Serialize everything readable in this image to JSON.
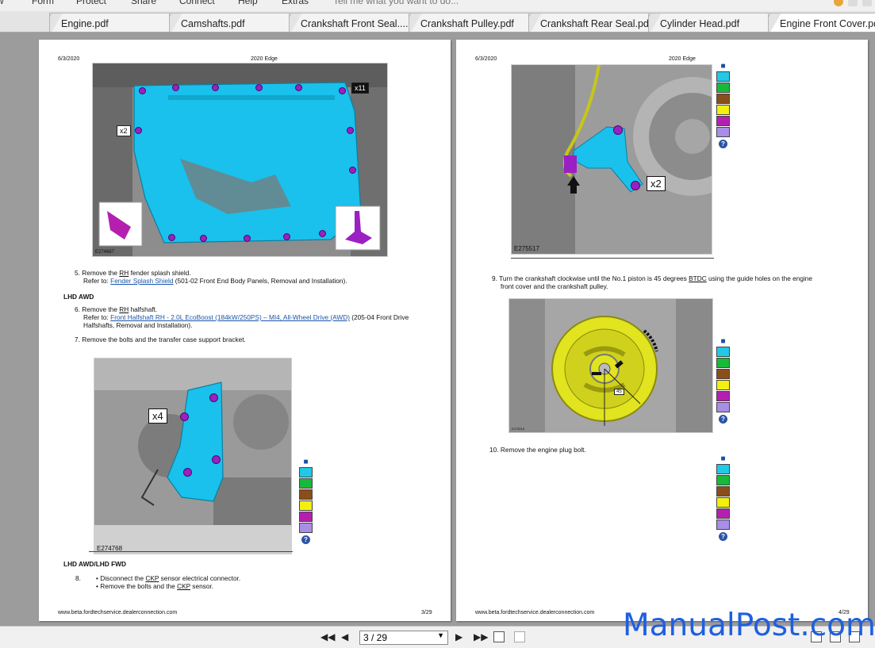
{
  "menu": {
    "items": [
      "Form",
      "Protect",
      "Share",
      "Connect",
      "Help",
      "Extras"
    ],
    "tell_me": "Tell me what you want to do..."
  },
  "tabs": [
    {
      "label": "Engine.pdf",
      "active": false
    },
    {
      "label": "Camshafts.pdf",
      "active": false
    },
    {
      "label": "Crankshaft Front Seal....",
      "active": false
    },
    {
      "label": "Crankshaft Pulley.pdf",
      "active": false
    },
    {
      "label": "Crankshaft Rear Seal.pdf",
      "active": false
    },
    {
      "label": "Cylinder Head.pdf",
      "active": false
    },
    {
      "label": "Engine Front Cover.pdf",
      "active": true
    }
  ],
  "page_left": {
    "date": "6/3/2020",
    "title": "2020 Edge",
    "fig1_id": "E274667",
    "fig1_callouts": [
      "x2",
      "x11"
    ],
    "step5": {
      "num": "5.",
      "text_pre": "Remove the ",
      "rh": "RH",
      "text_post": " fender splash shield.",
      "refer": "Refer to: ",
      "link": "Fender Splash Shield",
      "tail": " (501-02 Front End Body Panels, Removal and Installation)."
    },
    "section1": "LHD AWD",
    "step6": {
      "num": "6.",
      "text_pre": "Remove the ",
      "rh": "RH",
      "text_post": " halfshaft.",
      "refer": "Refer to: ",
      "link": "Front Halfshaft RH - 2.0L EcoBoost (184kW/250PS) – MI4, All-Wheel Drive (AWD)",
      "tail": " (205-04 Front Drive",
      "tail2": "Halfshafts, Removal and Installation)."
    },
    "step7": {
      "num": "7.",
      "text": "Remove the bolts and the transfer case support bracket."
    },
    "fig2_id": "E274768",
    "fig2_callout": "x4",
    "section2": "LHD AWD/LHD FWD",
    "step8": {
      "num": "8.",
      "b1_pre": "Disconnect the ",
      "b1_ckp": "CKP",
      "b1_post": " sensor electrical connector.",
      "b2_pre": "Remove the bolts and the ",
      "b2_ckp": "CKP",
      "b2_post": " sensor."
    },
    "footer_url": "www.beta.fordtechservice.dealerconnection.com",
    "footer_page": "3/29"
  },
  "page_right": {
    "date": "6/3/2020",
    "title": "2020 Edge",
    "fig3_id": "E275517",
    "fig3_callout": "x2",
    "step9": {
      "num": "9.",
      "text_pre": "Turn the crankshaft clockwise until the No.1 piston is 45 degrees ",
      "btdc": "BTDC",
      "text_post": " using the guide holes on the engine",
      "line2": "front cover and the crankshaft pulley."
    },
    "fig4_label": "45",
    "fig4_id": "E275518",
    "step10": {
      "num": "10.",
      "text": "Remove the engine plug bolt."
    },
    "footer_url": "www.beta.fordtechservice.dealerconnection.com",
    "footer_page": "4/29"
  },
  "legend_colors": [
    "#22c8e6",
    "#18b93a",
    "#8a4e1b",
    "#f3ef10",
    "#b51fb0",
    "#a78ee6"
  ],
  "legend_help": "?",
  "colors": {
    "highlight_cyan": "#19c1ec",
    "bolt_purple": "#9b20c4",
    "pulley_yellow": "#e1e41e",
    "link_blue": "#1a55a8"
  },
  "nav": {
    "page_display": "3 / 29",
    "first_icon": "first-page-icon",
    "prev_icon": "prev-page-icon",
    "next_icon": "next-page-icon",
    "last_icon": "last-page-icon"
  },
  "watermark": "ManualPost.com"
}
